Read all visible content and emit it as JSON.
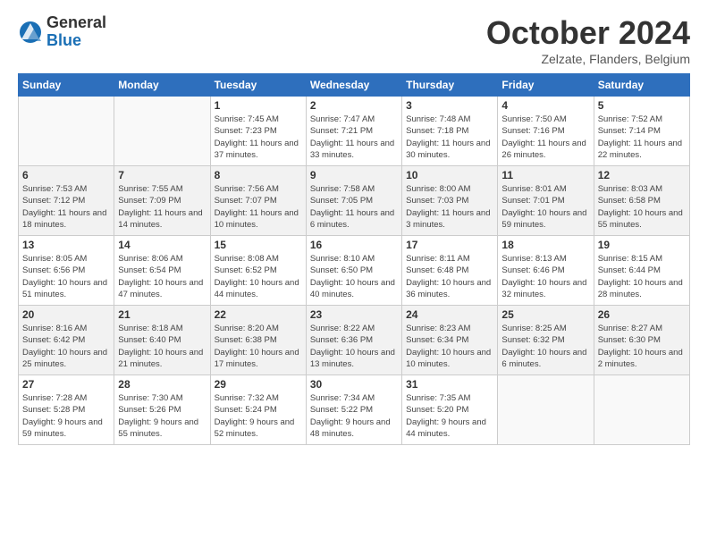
{
  "logo": {
    "general": "General",
    "blue": "Blue"
  },
  "title": "October 2024",
  "location": "Zelzate, Flanders, Belgium",
  "days_header": [
    "Sunday",
    "Monday",
    "Tuesday",
    "Wednesday",
    "Thursday",
    "Friday",
    "Saturday"
  ],
  "weeks": [
    [
      {
        "day": "",
        "info": ""
      },
      {
        "day": "",
        "info": ""
      },
      {
        "day": "1",
        "info": "Sunrise: 7:45 AM\nSunset: 7:23 PM\nDaylight: 11 hours and 37 minutes."
      },
      {
        "day": "2",
        "info": "Sunrise: 7:47 AM\nSunset: 7:21 PM\nDaylight: 11 hours and 33 minutes."
      },
      {
        "day": "3",
        "info": "Sunrise: 7:48 AM\nSunset: 7:18 PM\nDaylight: 11 hours and 30 minutes."
      },
      {
        "day": "4",
        "info": "Sunrise: 7:50 AM\nSunset: 7:16 PM\nDaylight: 11 hours and 26 minutes."
      },
      {
        "day": "5",
        "info": "Sunrise: 7:52 AM\nSunset: 7:14 PM\nDaylight: 11 hours and 22 minutes."
      }
    ],
    [
      {
        "day": "6",
        "info": "Sunrise: 7:53 AM\nSunset: 7:12 PM\nDaylight: 11 hours and 18 minutes."
      },
      {
        "day": "7",
        "info": "Sunrise: 7:55 AM\nSunset: 7:09 PM\nDaylight: 11 hours and 14 minutes."
      },
      {
        "day": "8",
        "info": "Sunrise: 7:56 AM\nSunset: 7:07 PM\nDaylight: 11 hours and 10 minutes."
      },
      {
        "day": "9",
        "info": "Sunrise: 7:58 AM\nSunset: 7:05 PM\nDaylight: 11 hours and 6 minutes."
      },
      {
        "day": "10",
        "info": "Sunrise: 8:00 AM\nSunset: 7:03 PM\nDaylight: 11 hours and 3 minutes."
      },
      {
        "day": "11",
        "info": "Sunrise: 8:01 AM\nSunset: 7:01 PM\nDaylight: 10 hours and 59 minutes."
      },
      {
        "day": "12",
        "info": "Sunrise: 8:03 AM\nSunset: 6:58 PM\nDaylight: 10 hours and 55 minutes."
      }
    ],
    [
      {
        "day": "13",
        "info": "Sunrise: 8:05 AM\nSunset: 6:56 PM\nDaylight: 10 hours and 51 minutes."
      },
      {
        "day": "14",
        "info": "Sunrise: 8:06 AM\nSunset: 6:54 PM\nDaylight: 10 hours and 47 minutes."
      },
      {
        "day": "15",
        "info": "Sunrise: 8:08 AM\nSunset: 6:52 PM\nDaylight: 10 hours and 44 minutes."
      },
      {
        "day": "16",
        "info": "Sunrise: 8:10 AM\nSunset: 6:50 PM\nDaylight: 10 hours and 40 minutes."
      },
      {
        "day": "17",
        "info": "Sunrise: 8:11 AM\nSunset: 6:48 PM\nDaylight: 10 hours and 36 minutes."
      },
      {
        "day": "18",
        "info": "Sunrise: 8:13 AM\nSunset: 6:46 PM\nDaylight: 10 hours and 32 minutes."
      },
      {
        "day": "19",
        "info": "Sunrise: 8:15 AM\nSunset: 6:44 PM\nDaylight: 10 hours and 28 minutes."
      }
    ],
    [
      {
        "day": "20",
        "info": "Sunrise: 8:16 AM\nSunset: 6:42 PM\nDaylight: 10 hours and 25 minutes."
      },
      {
        "day": "21",
        "info": "Sunrise: 8:18 AM\nSunset: 6:40 PM\nDaylight: 10 hours and 21 minutes."
      },
      {
        "day": "22",
        "info": "Sunrise: 8:20 AM\nSunset: 6:38 PM\nDaylight: 10 hours and 17 minutes."
      },
      {
        "day": "23",
        "info": "Sunrise: 8:22 AM\nSunset: 6:36 PM\nDaylight: 10 hours and 13 minutes."
      },
      {
        "day": "24",
        "info": "Sunrise: 8:23 AM\nSunset: 6:34 PM\nDaylight: 10 hours and 10 minutes."
      },
      {
        "day": "25",
        "info": "Sunrise: 8:25 AM\nSunset: 6:32 PM\nDaylight: 10 hours and 6 minutes."
      },
      {
        "day": "26",
        "info": "Sunrise: 8:27 AM\nSunset: 6:30 PM\nDaylight: 10 hours and 2 minutes."
      }
    ],
    [
      {
        "day": "27",
        "info": "Sunrise: 7:28 AM\nSunset: 5:28 PM\nDaylight: 9 hours and 59 minutes."
      },
      {
        "day": "28",
        "info": "Sunrise: 7:30 AM\nSunset: 5:26 PM\nDaylight: 9 hours and 55 minutes."
      },
      {
        "day": "29",
        "info": "Sunrise: 7:32 AM\nSunset: 5:24 PM\nDaylight: 9 hours and 52 minutes."
      },
      {
        "day": "30",
        "info": "Sunrise: 7:34 AM\nSunset: 5:22 PM\nDaylight: 9 hours and 48 minutes."
      },
      {
        "day": "31",
        "info": "Sunrise: 7:35 AM\nSunset: 5:20 PM\nDaylight: 9 hours and 44 minutes."
      },
      {
        "day": "",
        "info": ""
      },
      {
        "day": "",
        "info": ""
      }
    ]
  ]
}
